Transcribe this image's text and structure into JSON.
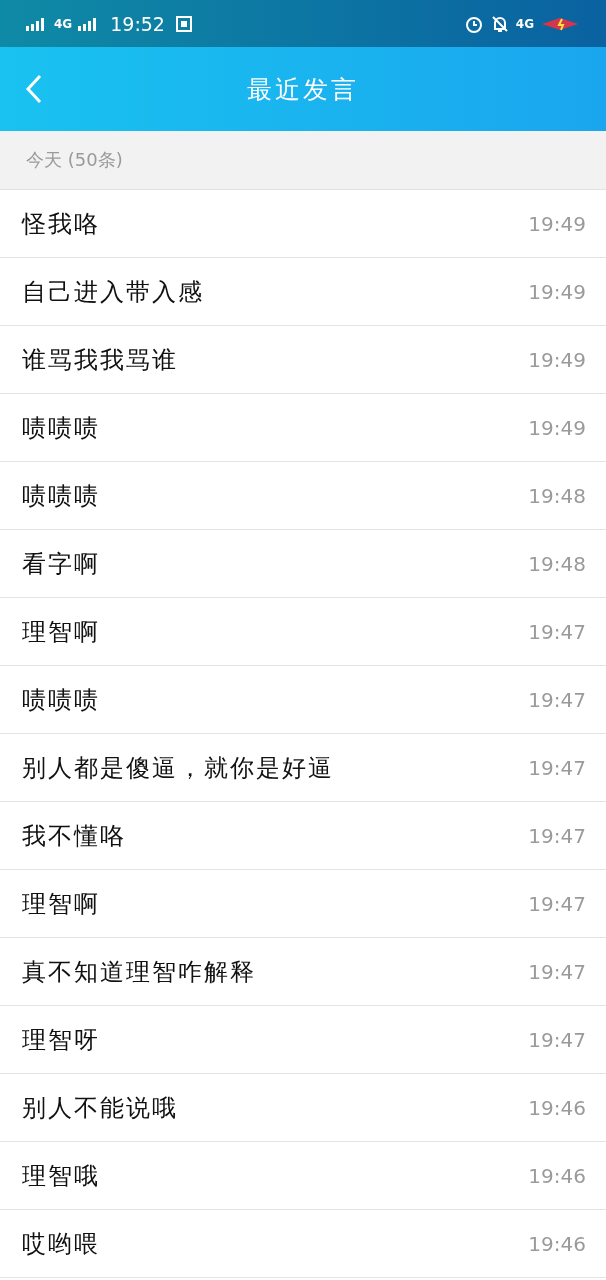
{
  "status_bar": {
    "time": "19:52",
    "network_left": "4G",
    "network_right": "4G"
  },
  "nav": {
    "title": "最近发言"
  },
  "section": {
    "label": "今天 (50条)"
  },
  "messages": [
    {
      "text": "怪我咯",
      "time": "19:49"
    },
    {
      "text": "自己进入带入感",
      "time": "19:49"
    },
    {
      "text": "谁骂我我骂谁",
      "time": "19:49"
    },
    {
      "text": "啧啧啧",
      "time": "19:49"
    },
    {
      "text": "啧啧啧",
      "time": "19:48"
    },
    {
      "text": "看字啊",
      "time": "19:48"
    },
    {
      "text": "理智啊",
      "time": "19:47"
    },
    {
      "text": "啧啧啧",
      "time": "19:47"
    },
    {
      "text": "别人都是傻逼，就你是好逼",
      "time": "19:47"
    },
    {
      "text": "我不懂咯",
      "time": "19:47"
    },
    {
      "text": "理智啊",
      "time": "19:47"
    },
    {
      "text": "真不知道理智咋解释",
      "time": "19:47"
    },
    {
      "text": "理智呀",
      "time": "19:47"
    },
    {
      "text": "别人不能说哦",
      "time": "19:46"
    },
    {
      "text": "理智哦",
      "time": "19:46"
    },
    {
      "text": "哎哟喂",
      "time": "19:46"
    }
  ]
}
